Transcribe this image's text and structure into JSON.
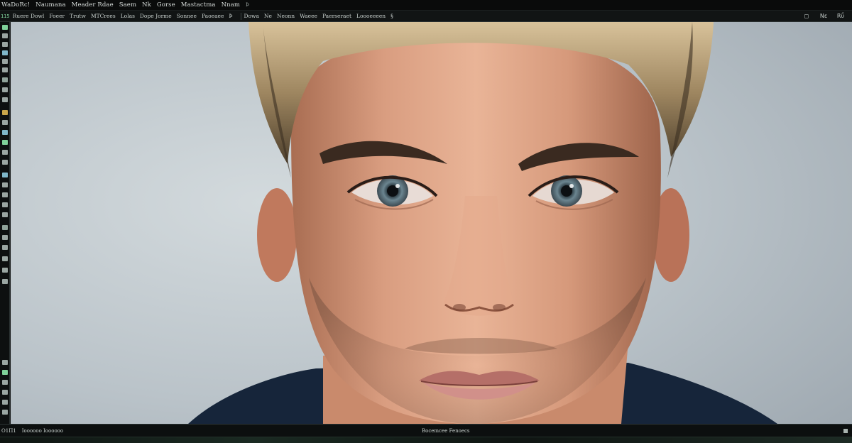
{
  "menubar": {
    "items": [
      "WaDoRc!",
      "Naumana",
      "Meader Rdae",
      "Saem",
      "Nk",
      "Gorse",
      "Mastactma",
      "Nnam",
      "Þ"
    ]
  },
  "toolbar": {
    "tool_id": "115",
    "items": [
      "Ruere Dowl",
      "Foeer",
      "Trutw",
      "MTCrees",
      "Lolas",
      "Dope Jorme",
      "Sonnee",
      "Paoeaee",
      "Þ",
      "Dowa",
      "Ne",
      "Neonn",
      "Waeee",
      "Paerseraet",
      "Loooeeeen",
      "§"
    ],
    "window_controls": [
      "◻",
      "Nε",
      "Rΰ"
    ]
  },
  "colors": {
    "chrome_bg": "#0b0d0d",
    "accent_green": "#7fd19a",
    "canvas_bg": "#bcc5cb"
  },
  "statusbar": {
    "left_items": [
      "Ο1Π1",
      "Ιοοοοοο Ιοοοοοο"
    ],
    "center_text": "Bocemcee Fenoecs"
  }
}
